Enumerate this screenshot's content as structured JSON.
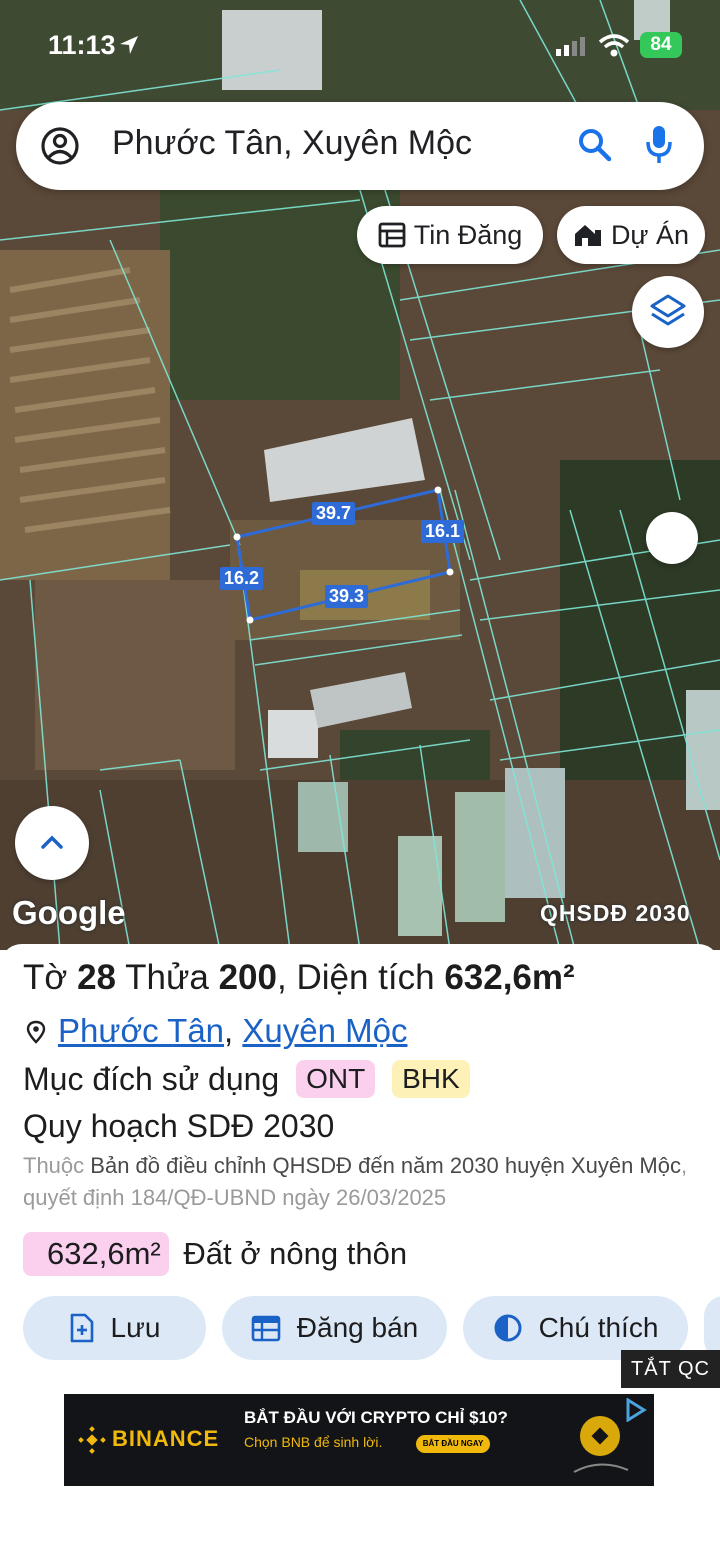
{
  "status_bar": {
    "time": "11:13",
    "battery": "84"
  },
  "search": {
    "query": "Phước Tân, Xuyên Mộc"
  },
  "chips": {
    "tin_dang": "Tin Đăng",
    "du_an": "Dự Án"
  },
  "map": {
    "google_label": "Google",
    "layer_label": "QHSDĐ 2030",
    "dimensions": {
      "top": "39.7",
      "right": "16.1",
      "left": "16.2",
      "bottom": "39.3"
    }
  },
  "parcel": {
    "to_label": "Tờ",
    "to_value": "28",
    "thua_label": "Thửa",
    "thua_value": "200",
    "dien_tich_label": ", Diện tích",
    "dien_tich_value": "632,6m²",
    "ward": "Phước Tân",
    "district": "Xuyên Mộc",
    "purpose_label": "Mục đích sử dụng",
    "purpose_badges": [
      "ONT",
      "BHK"
    ],
    "planning_label": "Quy hoạch SDĐ 2030",
    "desc_prefix": "Thuộc",
    "desc_map": "Bản đồ điều chỉnh QHSDĐ đến năm 2030 huyện Xuyên Mộc",
    "desc_decision": ", quyết định 184/QĐ-UBND ngày 26/03/2025",
    "area_value": "632,6m²",
    "area_type": "Đất ở nông thôn"
  },
  "actions": {
    "save": "Lưu",
    "post_sale": "Đăng bán",
    "legend": "Chú thích"
  },
  "ad": {
    "close_label": "TẮT QC",
    "brand": "BINANCE",
    "headline": "BẮT ĐẦU VỚI CRYPTO CHỈ $10?",
    "subline": "Chọn BNB để sinh lời.",
    "cta": "BẮT ĐẦU NGAY"
  },
  "colors": {
    "accent": "#1a62c5",
    "button_bg": "#dce8f6",
    "parcel_line": "#2f6bd6",
    "binance": "#f0b90b"
  }
}
